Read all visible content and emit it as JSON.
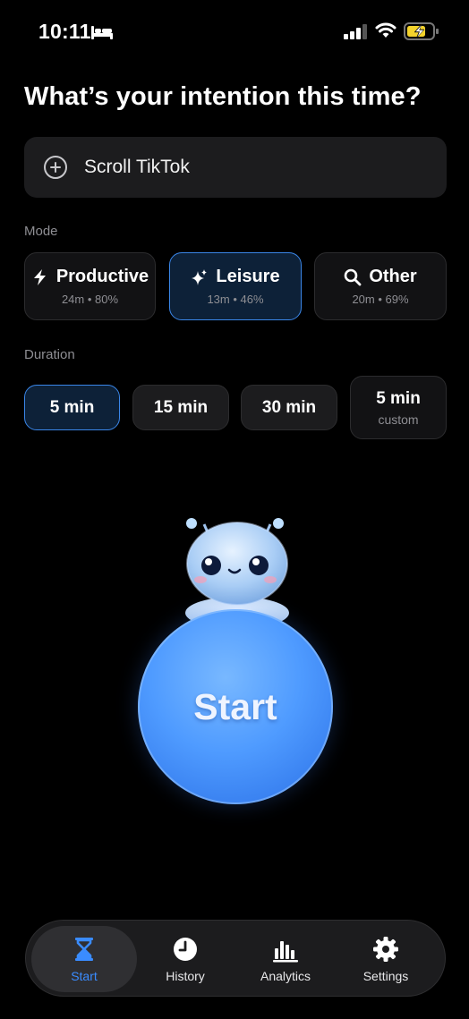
{
  "status_bar": {
    "time": "10:11"
  },
  "title": "What’s your intention this time?",
  "intention": {
    "value": "Scroll TikTok"
  },
  "mode": {
    "label": "Mode",
    "options": [
      {
        "name": "Productive",
        "stats": "24m • 80%",
        "icon": "bolt-icon"
      },
      {
        "name": "Leisure",
        "stats": "13m • 46%",
        "icon": "sparkles-icon",
        "selected": true
      },
      {
        "name": "Other",
        "stats": "20m • 69%",
        "icon": "search-icon"
      }
    ]
  },
  "duration": {
    "label": "Duration",
    "options": [
      {
        "label": "5 min",
        "selected": true
      },
      {
        "label": "15 min"
      },
      {
        "label": "30 min"
      },
      {
        "label": "5 min",
        "sub": "custom"
      }
    ]
  },
  "start": {
    "label": "Start"
  },
  "tabbar": {
    "tabs": [
      {
        "label": "Start",
        "icon": "hourglass-icon",
        "active": true
      },
      {
        "label": "History",
        "icon": "clock-icon"
      },
      {
        "label": "Analytics",
        "icon": "bar-chart-icon"
      },
      {
        "label": "Settings",
        "icon": "gear-icon"
      }
    ]
  },
  "colors": {
    "accent": "#3a8cff",
    "selected_bg": "#0d2138",
    "start_button": "#4f9bff"
  }
}
